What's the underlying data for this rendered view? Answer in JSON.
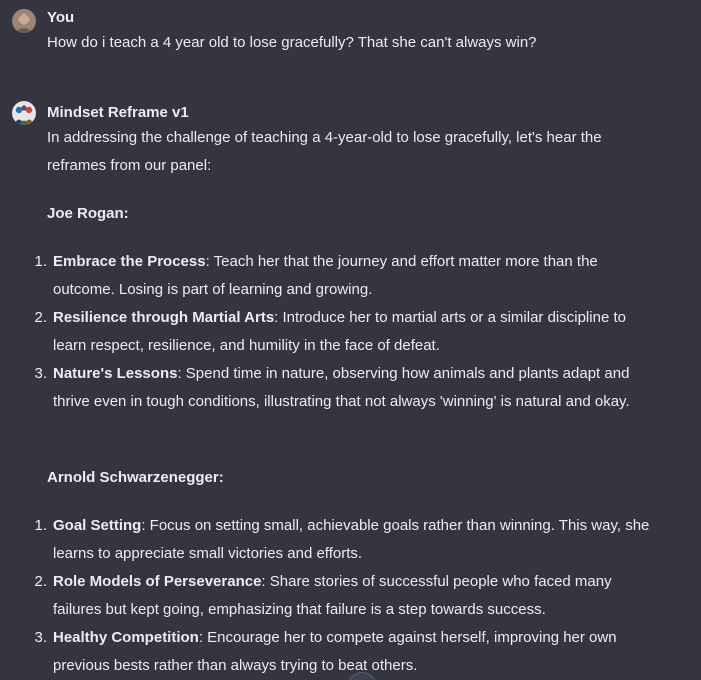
{
  "user_message": {
    "author": "You",
    "text": "How do i teach a 4 year old to lose gracefully? That she can't always win?"
  },
  "assistant_message": {
    "author": "Mindset Reframe v1",
    "intro": "In addressing the challenge of teaching a 4-year-old to lose gracefully, let's hear the reframes from our panel:",
    "sections": [
      {
        "heading": "Joe Rogan:",
        "items": [
          {
            "num": "1.",
            "title": "Embrace the Process",
            "text": ": Teach her that the journey and effort matter more than the outcome. Losing is part of learning and growing."
          },
          {
            "num": "2.",
            "title": "Resilience through Martial Arts",
            "text": ": Introduce her to martial arts or a similar discipline to learn respect, resilience, and humility in the face of defeat."
          },
          {
            "num": "3.",
            "title": "Nature's Lessons",
            "text": ": Spend time in nature, observing how animals and plants adapt and thrive even in tough conditions, illustrating that not always 'winning' is natural and okay."
          }
        ]
      },
      {
        "heading": "Arnold Schwarzenegger:",
        "items": [
          {
            "num": "1.",
            "title": "Goal Setting",
            "text": ": Focus on setting small, achievable goals rather than winning. This way, she learns to appreciate small victories and efforts."
          },
          {
            "num": "2.",
            "title": "Role Models of Perseverance",
            "text": ": Share stories of successful people who faced many failures but kept going, emphasizing that failure is a step towards success."
          },
          {
            "num": "3.",
            "title": "Healthy Competition",
            "text": ": Encourage her to compete against herself, improving her own previous bests rather than always trying to beat others."
          }
        ]
      }
    ]
  },
  "colors": {
    "background": "#343541",
    "text": "#ececf1"
  },
  "icons": {
    "user_avatar": "user-photo-avatar",
    "assistant_avatar": "gpt-avatar"
  }
}
